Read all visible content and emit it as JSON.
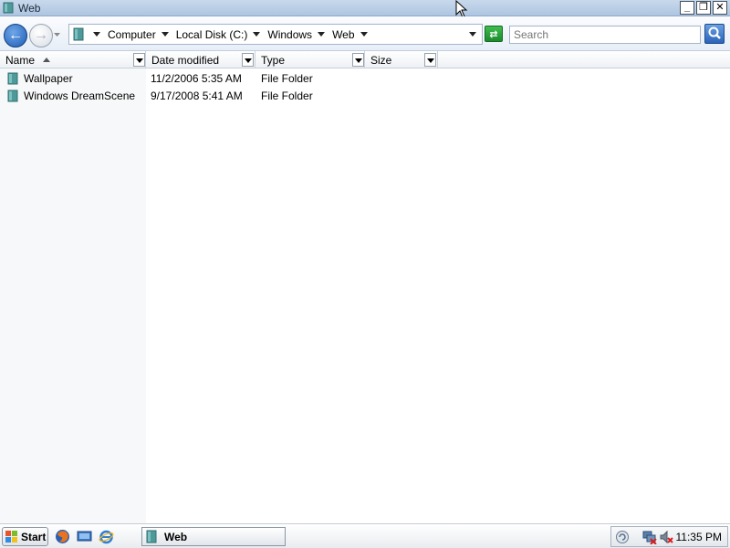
{
  "window": {
    "title": "Web",
    "controls": {
      "minimize": "_",
      "restore": "❐",
      "close": "✕"
    }
  },
  "navigation": {
    "back_icon": "back-arrow-icon",
    "forward_icon": "forward-arrow-icon",
    "breadcrumbs": [
      "Computer",
      "Local Disk (C:)",
      "Windows",
      "Web"
    ],
    "search_placeholder": "Search"
  },
  "columns": [
    {
      "label": "Name",
      "sorted": "ascending"
    },
    {
      "label": "Date modified"
    },
    {
      "label": "Type"
    },
    {
      "label": "Size"
    }
  ],
  "files": [
    {
      "name": "Wallpaper",
      "date_modified": "11/2/2006 5:35 AM",
      "type": "File Folder",
      "size": ""
    },
    {
      "name": "Windows DreamScene",
      "date_modified": "9/17/2008 5:41 AM",
      "type": "File Folder",
      "size": ""
    }
  ],
  "taskbar": {
    "start_label": "Start",
    "quick_launch": [
      "firefox-icon",
      "show-desktop-icon",
      "internet-explorer-icon"
    ],
    "tasks": [
      {
        "label": "Web",
        "icon": "folder-icon"
      }
    ],
    "tray_icons": [
      "update-icon",
      "network-disconnected-icon",
      "volume-muted-icon"
    ],
    "clock": "11:35 PM"
  },
  "colors": {
    "titlebar": "#b9cfe6",
    "accent_blue": "#1f5db6",
    "folder_teal": "#4e9a9a"
  }
}
